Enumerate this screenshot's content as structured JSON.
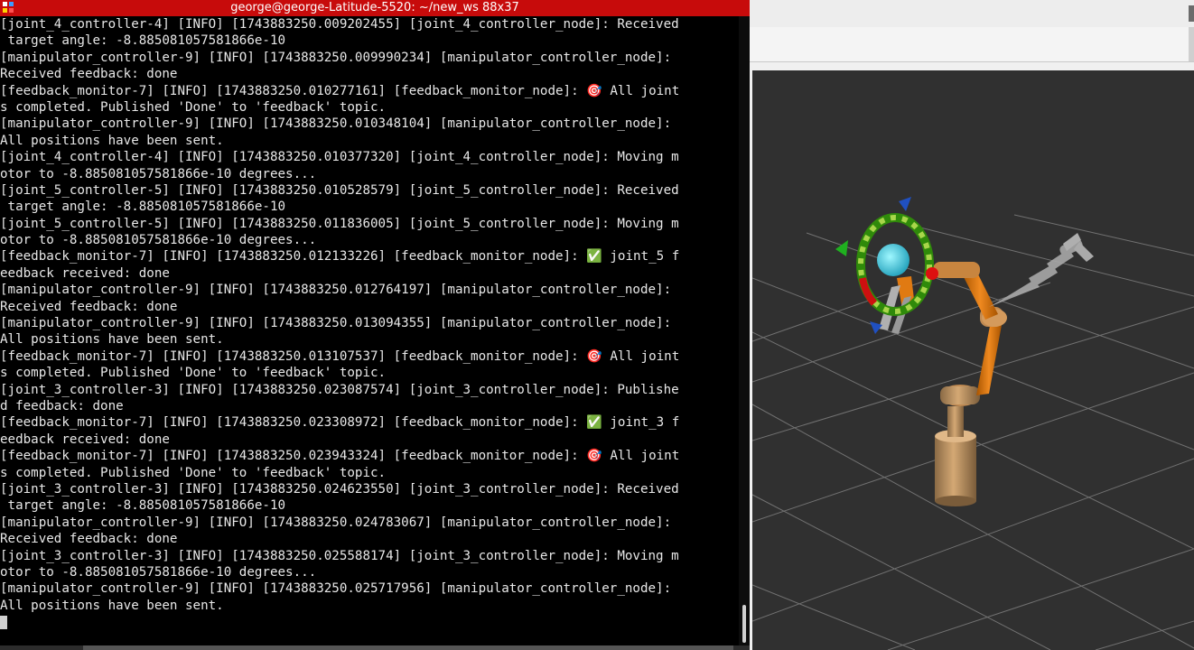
{
  "terminal": {
    "title": "george@george-Latitude-5520: ~/new_ws 88x37",
    "lines": [
      "[joint_4_controller-4] [INFO] [1743883250.009202455] [joint_4_controller_node]: Received",
      " target angle: -8.885081057581866e-10",
      "[manipulator_controller-9] [INFO] [1743883250.009990234] [manipulator_controller_node]:",
      "Received feedback: done",
      "[feedback_monitor-7] [INFO] [1743883250.010277161] [feedback_monitor_node]: 🎯 All joint",
      "s completed. Published 'Done' to 'feedback' topic.",
      "[manipulator_controller-9] [INFO] [1743883250.010348104] [manipulator_controller_node]:",
      "All positions have been sent.",
      "[joint_4_controller-4] [INFO] [1743883250.010377320] [joint_4_controller_node]: Moving m",
      "otor to -8.885081057581866e-10 degrees...",
      "[joint_5_controller-5] [INFO] [1743883250.010528579] [joint_5_controller_node]: Received",
      " target angle: -8.885081057581866e-10",
      "[joint_5_controller-5] [INFO] [1743883250.011836005] [joint_5_controller_node]: Moving m",
      "otor to -8.885081057581866e-10 degrees...",
      "[feedback_monitor-7] [INFO] [1743883250.012133226] [feedback_monitor_node]: ✅ joint_5 f",
      "eedback received: done",
      "[manipulator_controller-9] [INFO] [1743883250.012764197] [manipulator_controller_node]:",
      "Received feedback: done",
      "[manipulator_controller-9] [INFO] [1743883250.013094355] [manipulator_controller_node]:",
      "All positions have been sent.",
      "[feedback_monitor-7] [INFO] [1743883250.013107537] [feedback_monitor_node]: 🎯 All joint",
      "s completed. Published 'Done' to 'feedback' topic.",
      "[joint_3_controller-3] [INFO] [1743883250.023087574] [joint_3_controller_node]: Publishe",
      "d feedback: done",
      "[feedback_monitor-7] [INFO] [1743883250.023308972] [feedback_monitor_node]: ✅ joint_3 f",
      "eedback received: done",
      "[feedback_monitor-7] [INFO] [1743883250.023943324] [feedback_monitor_node]: 🎯 All joint",
      "s completed. Published 'Done' to 'feedback' topic.",
      "[joint_3_controller-3] [INFO] [1743883250.024623550] [joint_3_controller_node]: Received",
      " target angle: -8.885081057581866e-10",
      "[manipulator_controller-9] [INFO] [1743883250.024783067] [manipulator_controller_node]:",
      "Received feedback: done",
      "[joint_3_controller-3] [INFO] [1743883250.025588174] [joint_3_controller_node]: Moving m",
      "otor to -8.885081057581866e-10 degrees...",
      "[manipulator_controller-9] [INFO] [1743883250.025717956] [manipulator_controller_node]:",
      "All positions have been sent."
    ]
  },
  "colors": {
    "titlebar": "#c70b0b",
    "terminal_bg": "#000000",
    "terminal_text": "#e8e8e8",
    "viewport_bg": "#303030",
    "robot_orange": "#e07a12",
    "robot_tan": "#c89860",
    "robot_gray": "#a0a0a0"
  },
  "icons": {
    "terminal_app": "terminal-app-icon",
    "target": "target-emoji",
    "check": "check-mark-emoji"
  }
}
